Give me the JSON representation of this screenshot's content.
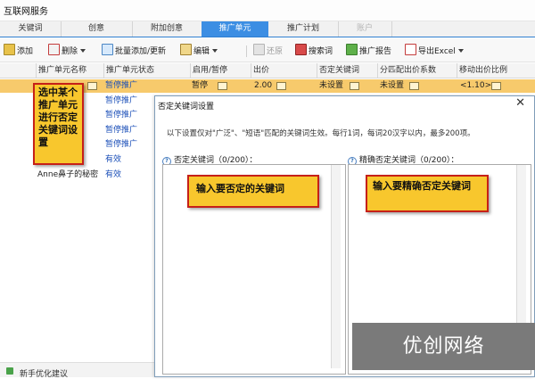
{
  "app": {
    "title": "互联网服务"
  },
  "tabs": [
    {
      "label": "关键词"
    },
    {
      "label": "创意"
    },
    {
      "label": "附加创意"
    },
    {
      "label": "推广单元"
    },
    {
      "label": "推广计划"
    },
    {
      "label": "账户"
    }
  ],
  "toolbar": {
    "add": "添加",
    "delete": "删除",
    "batch_add": "批量添加/更新",
    "edit": "编辑",
    "restore": "还原",
    "search_terms": "搜索词",
    "report": "推广报告",
    "export_excel": "导出Excel"
  },
  "grid": {
    "columns": [
      "推广单元名称",
      "推广单元状态",
      "启用/暂停",
      "出价",
      "否定关键词",
      "分匹配出价系数",
      "移动出价比例"
    ],
    "selected_row": {
      "name": "",
      "status": "暂停推广",
      "enabled": "暂停",
      "bid": "2.00",
      "negative": "未设置",
      "match_coef": "未设置",
      "mobile_ratio": "<1.10>"
    },
    "rows": [
      {
        "name": "",
        "status": "暂停推广"
      },
      {
        "name": "",
        "status": "暂停推广"
      },
      {
        "name": "",
        "status": "暂停推广"
      },
      {
        "name": "",
        "status": "暂停推广"
      },
      {
        "name": "",
        "status": "有效"
      },
      {
        "name": "Anne鼻子的秘密",
        "status": "有效"
      }
    ]
  },
  "bottom_panel": {
    "label": "新手优化建议"
  },
  "dialog": {
    "title": "否定关键词设置",
    "close_glyph": "✕",
    "description": "以下设置仅对\"广泛\"、\"短语\"匹配的关键词生效。每行1词，每词20汉字以内，最多200项。",
    "negative_label": "否定关键词（0/200）：",
    "negative_value": "",
    "exact_label": "精确否定关键词（0/200）：",
    "exact_value": ""
  },
  "callouts": {
    "select_unit": "选中某个推广单元进行否定关键词设置",
    "enter_negative": "输入要否定的关键词",
    "enter_exact": "输入要精确否定关键词"
  },
  "watermark": "优创网络",
  "colors": {
    "tab_active": "#3c8ee3",
    "selected_row": "#f7ca6c",
    "callout_fill": "#f8c72d",
    "callout_border": "#c62018",
    "link_blue": "#1b4fb8"
  }
}
